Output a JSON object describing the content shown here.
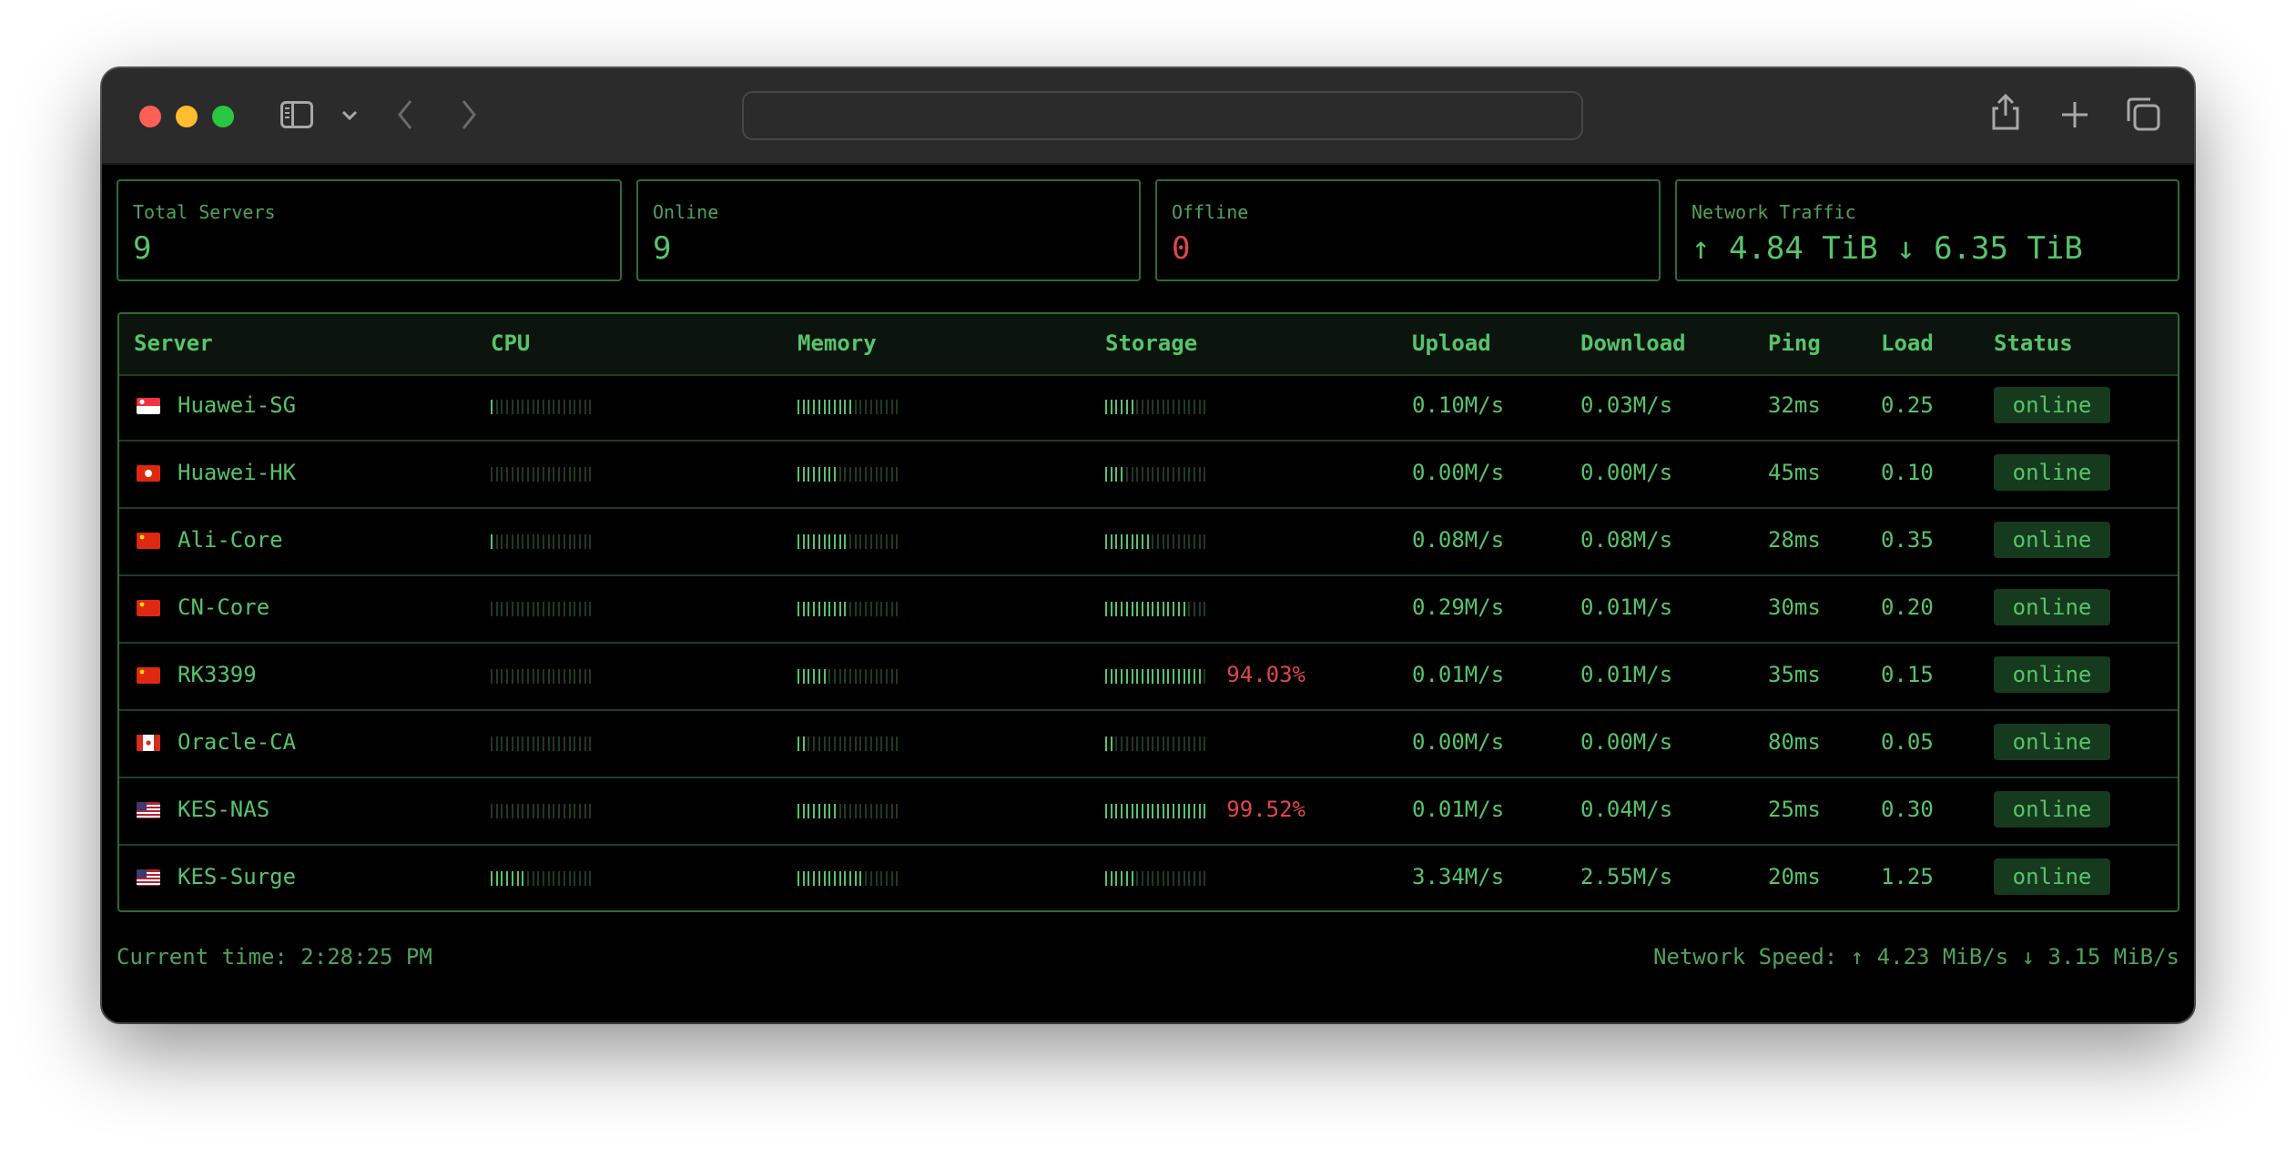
{
  "summary": {
    "total_label": "Total Servers",
    "total_value": "9",
    "online_label": "Online",
    "online_value": "9",
    "offline_label": "Offline",
    "offline_value": "0",
    "traffic_label": "Network Traffic",
    "traffic_value": "↑ 4.84 TiB ↓ 6.35 TiB"
  },
  "table": {
    "headers": [
      "Server",
      "CPU",
      "Memory",
      "Storage",
      "Upload",
      "Download",
      "Ping",
      "Load",
      "Status"
    ],
    "rows": [
      {
        "flag": "sg",
        "name": "Huawei-SG",
        "cpu": 4.35,
        "cpu_text": "4.35%",
        "mem": 57.14,
        "mem_text": "57.14%",
        "sto": 27.77,
        "sto_text": "27.77%",
        "upload": "0.10M/s",
        "download": "0.03M/s",
        "ping": "32ms",
        "load": "0.25",
        "status": "online"
      },
      {
        "flag": "hk",
        "name": "Huawei-HK",
        "cpu": 0.0,
        "cpu_text": "0.00%",
        "mem": 39.19,
        "mem_text": "39.19%",
        "sto": 19.9,
        "sto_text": "19.90%",
        "upload": "0.00M/s",
        "download": "0.00M/s",
        "ping": "45ms",
        "load": "0.10",
        "status": "online"
      },
      {
        "flag": "cn",
        "name": "Ali-Core",
        "cpu": 4.55,
        "cpu_text": "4.55%",
        "mem": 47.51,
        "mem_text": "47.51%",
        "sto": 45.83,
        "sto_text": "45.83%",
        "upload": "0.08M/s",
        "download": "0.08M/s",
        "ping": "28ms",
        "load": "0.35",
        "status": "online"
      },
      {
        "flag": "cn",
        "name": "CN-Core",
        "cpu": 1.34,
        "cpu_text": "1.34%",
        "mem": 49.86,
        "mem_text": "49.86%",
        "sto": 78.65,
        "sto_text": "78.65%",
        "upload": "0.29M/s",
        "download": "0.01M/s",
        "ping": "30ms",
        "load": "0.20",
        "status": "online"
      },
      {
        "flag": "cn",
        "name": "RK3399",
        "cpu": 2.35,
        "cpu_text": "2.35%",
        "mem": 31.08,
        "mem_text": "31.08%",
        "sto": 94.03,
        "sto_text": "94.03%",
        "upload": "0.01M/s",
        "download": "0.01M/s",
        "ping": "35ms",
        "load": "0.15",
        "status": "online"
      },
      {
        "flag": "ca",
        "name": "Oracle-CA",
        "cpu": 2.38,
        "cpu_text": "2.38%",
        "mem": 11.03,
        "mem_text": "11.03%",
        "sto": 9.55,
        "sto_text": "9.55%",
        "upload": "0.00M/s",
        "download": "0.00M/s",
        "ping": "80ms",
        "load": "0.05",
        "status": "online"
      },
      {
        "flag": "us",
        "name": "KES-NAS",
        "cpu": 1.99,
        "cpu_text": "1.99%",
        "mem": 38.56,
        "mem_text": "38.56%",
        "sto": 99.52,
        "sto_text": "99.52%",
        "upload": "0.01M/s",
        "download": "0.04M/s",
        "ping": "25ms",
        "load": "0.30",
        "status": "online"
      },
      {
        "flag": "us",
        "name": "KES-Surge",
        "cpu": 32.75,
        "cpu_text": "32.75%",
        "mem": 63.38,
        "mem_text": "63.38%",
        "sto": 32.27,
        "sto_text": "32.27%",
        "upload": "3.34M/s",
        "download": "2.55M/s",
        "ping": "20ms",
        "load": "1.25",
        "status": "online"
      }
    ]
  },
  "footer": {
    "time": "Current time: 2:28:25 PM",
    "speed": "Network Speed: ↑ 4.23 MiB/s ↓ 3.15 MiB/s"
  },
  "colors": {
    "accent": "#57c46a",
    "alert": "#e0464a",
    "border": "#2e6b35",
    "track": "#1f3a24"
  }
}
